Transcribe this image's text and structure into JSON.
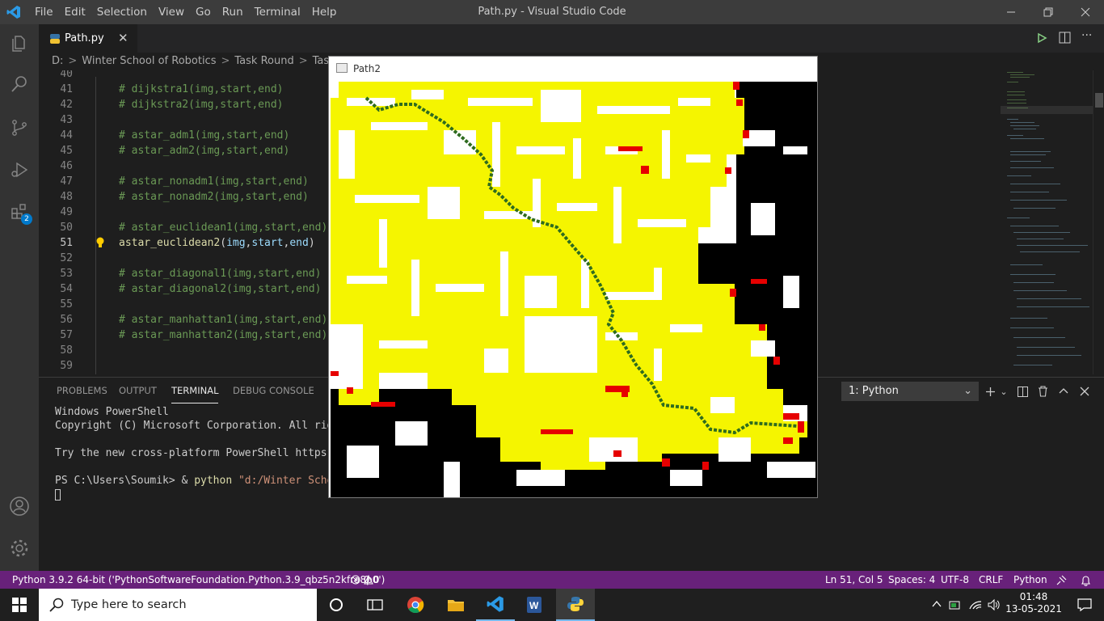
{
  "window": {
    "title": "Path.py - Visual Studio Code",
    "menu": [
      "File",
      "Edit",
      "Selection",
      "View",
      "Go",
      "Run",
      "Terminal",
      "Help"
    ]
  },
  "tab": {
    "label": "Path.py"
  },
  "breadcrumb": [
    "D:",
    "Winter School of Robotics",
    "Task Round",
    "Task 1"
  ],
  "editor": {
    "lines": [
      {
        "num": "40",
        "code": ""
      },
      {
        "num": "41",
        "code": "# dijkstra1(img,start,end)"
      },
      {
        "num": "42",
        "code": "# dijkstra2(img,start,end)"
      },
      {
        "num": "43",
        "code": ""
      },
      {
        "num": "44",
        "code": "# astar_adm1(img,start,end)"
      },
      {
        "num": "45",
        "code": "# astar_adm2(img,start,end)"
      },
      {
        "num": "46",
        "code": ""
      },
      {
        "num": "47",
        "code": "# astar_nonadm1(img,start,end)"
      },
      {
        "num": "48",
        "code": "# astar_nonadm2(img,start,end)"
      },
      {
        "num": "49",
        "code": ""
      },
      {
        "num": "50",
        "code": "# astar_euclidean1(img,start,end)"
      },
      {
        "num": "51",
        "code": "astar_euclidean2(img,start,end)"
      },
      {
        "num": "52",
        "code": ""
      },
      {
        "num": "53",
        "code": "# astar_diagonal1(img,start,end)"
      },
      {
        "num": "54",
        "code": "# astar_diagonal2(img,start,end)"
      },
      {
        "num": "55",
        "code": ""
      },
      {
        "num": "56",
        "code": "# astar_manhattan1(img,start,end)"
      },
      {
        "num": "57",
        "code": "# astar_manhattan2(img,start,end)"
      },
      {
        "num": "58",
        "code": ""
      },
      {
        "num": "59",
        "code": ""
      }
    ],
    "active_fn": "astar_euclidean2",
    "active_args": [
      "img",
      "start",
      "end"
    ]
  },
  "panel": {
    "tabs": [
      "PROBLEMS",
      "OUTPUT",
      "TERMINAL",
      "DEBUG CONSOLE"
    ],
    "active_tab": "TERMINAL",
    "terminal_select": "1: Python",
    "terminal": {
      "line1": "Windows PowerShell",
      "line2": "Copyright (C) Microsoft Corporation. All rights r",
      "line3": "Try the new cross-platform PowerShell https://aka",
      "prompt": "PS C:\\Users\\Soumik> & ",
      "cmd": "python",
      "arg": " \"d:/Winter School of"
    }
  },
  "popup": {
    "title": "Path2"
  },
  "status": {
    "interpreter": "Python 3.9.2 64-bit ('PythonSoftwareFoundation.Python.3.9_qbz5n2kfra8p0')",
    "problems": "0",
    "warnings": "0",
    "position": "Ln 51, Col 5",
    "spaces": "Spaces: 4",
    "encoding": "UTF-8",
    "eol": "CRLF",
    "language": "Python"
  },
  "taskbar": {
    "search_placeholder": "Type here to search",
    "time": "01:48",
    "date": "13-05-2021"
  },
  "colors": {
    "accent": "#007acc",
    "statusbar": "#68217a",
    "maze_free": "#f5f500",
    "maze_path": "#2e6b1f",
    "maze_frontier": "#e60000"
  },
  "icons": {
    "activity": [
      "explorer-icon",
      "search-icon",
      "source-control-icon",
      "run-debug-icon",
      "extensions-icon",
      "account-icon",
      "settings-gear-icon"
    ]
  }
}
